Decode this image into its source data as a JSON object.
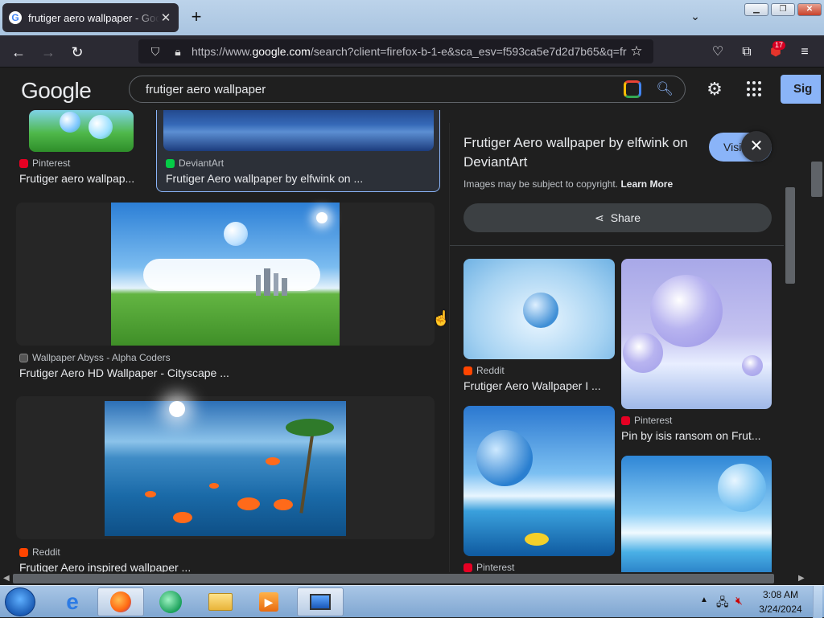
{
  "browser": {
    "tab_title": "frutiger aero wallpaper - Google Search",
    "new_tab_label": "+",
    "url": "https://www.google.com/search?client=firefox-b-1-e&sca_esv=f593ca5e7d2d7b65&q=fr",
    "url_host": "google.com",
    "url_prefix": "https://www.",
    "url_suffix": "/search?client=firefox-b-1-e&sca_esv=f593ca5e7d2d7b65&q=fr",
    "extensions_badge": "17"
  },
  "google": {
    "logo": "Google",
    "query": "frutiger aero wallpaper",
    "signin_label": "Sig"
  },
  "results": [
    {
      "source": "Pinterest",
      "title": "Frutiger aero wallpap...",
      "source_color": "#e60023"
    },
    {
      "source": "DeviantArt",
      "title": "Frutiger Aero wallpaper by elfwink on ...",
      "source_color": "#05cc47"
    },
    {
      "source": "Wallpaper Abyss - Alpha Coders",
      "title": "Frutiger Aero HD Wallpaper - Cityscape ...",
      "source_color": "#888888"
    },
    {
      "source": "Reddit",
      "title": "Frutiger Aero inspired wallpaper ...",
      "source_color": "#ff4500"
    }
  ],
  "panel": {
    "title": "Frutiger Aero wallpaper by elfwink on DeviantArt",
    "visit_label": "Visit",
    "copyright_text": "Images may be subject to copyright.",
    "learn_more": "Learn More",
    "share_label": "Share",
    "related": [
      {
        "source": "Reddit",
        "title": "Frutiger Aero Wallpaper I ...",
        "source_color": "#ff4500"
      },
      {
        "source": "Pinterest",
        "title": "Pin by isis ransom on Frut...",
        "source_color": "#e60023"
      },
      {
        "source": "Pinterest",
        "title": "",
        "source_color": "#e60023"
      }
    ]
  },
  "taskbar": {
    "time": "3:08 AM",
    "date": "3/24/2024"
  }
}
